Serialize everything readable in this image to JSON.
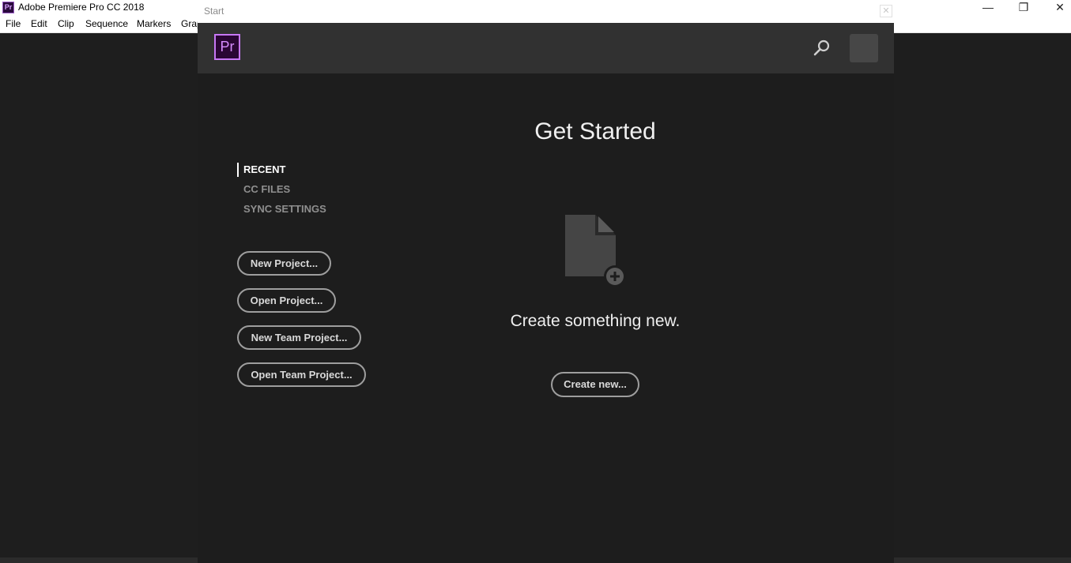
{
  "app": {
    "title": "Adobe Premiere Pro CC 2018",
    "icon_label": "Pr",
    "window_controls": {
      "minimize": "—",
      "maximize": "❐",
      "close": "✕"
    }
  },
  "menubar": {
    "items": [
      "File",
      "Edit",
      "Clip",
      "Sequence",
      "Markers",
      "Grap"
    ]
  },
  "dialog": {
    "title": "Start",
    "close_glyph": "✕",
    "logo_label": "Pr",
    "header": {
      "search_icon": "search-icon",
      "avatar": "user-avatar"
    },
    "nav": [
      {
        "label": "RECENT",
        "active": true
      },
      {
        "label": "CC FILES",
        "active": false
      },
      {
        "label": "SYNC SETTINGS",
        "active": false
      }
    ],
    "actions": [
      {
        "label": "New Project..."
      },
      {
        "label": "Open Project..."
      },
      {
        "label": "New Team Project..."
      },
      {
        "label": "Open Team Project..."
      }
    ],
    "main": {
      "heading": "Get Started",
      "empty_icon": "new-file-icon",
      "empty_text": "Create something new.",
      "create_button": "Create new..."
    }
  },
  "colors": {
    "workspace_bg": "#1e1e1e",
    "dialog_header": "#313131",
    "accent_purple": "#c777f5"
  }
}
